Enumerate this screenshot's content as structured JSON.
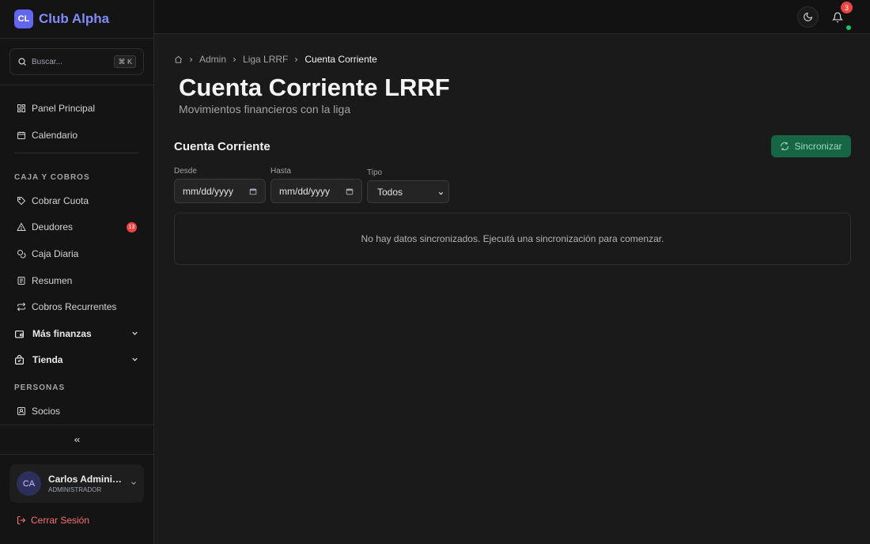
{
  "brand": {
    "logo": "CL",
    "name": "Club Alpha"
  },
  "search": {
    "placeholder": "Buscar...",
    "shortcut": "⌘ K"
  },
  "sidebar": {
    "top_items": [
      {
        "label": "Panel Principal",
        "icon": "dashboard-icon"
      },
      {
        "label": "Calendario",
        "icon": "calendar-icon"
      }
    ],
    "section_caja": "CAJA Y COBROS",
    "caja_items": [
      {
        "label": "Cobrar Cuota",
        "icon": "tag-icon"
      },
      {
        "label": "Deudores",
        "icon": "warning-icon",
        "badge": "13"
      },
      {
        "label": "Caja Diaria",
        "icon": "coins-icon"
      },
      {
        "label": "Resumen",
        "icon": "receipt-icon"
      },
      {
        "label": "Cobros Recurrentes",
        "icon": "repeat-icon"
      }
    ],
    "groups": [
      {
        "label": "Más finanzas",
        "icon": "wallet-icon"
      },
      {
        "label": "Tienda",
        "icon": "store-icon"
      }
    ],
    "section_personas": "PERSONAS",
    "personas_items": [
      {
        "label": "Socios",
        "icon": "id-card-icon"
      }
    ]
  },
  "user": {
    "initials": "CA",
    "name": "Carlos Administrador",
    "role": "ADMINISTRADOR"
  },
  "logout": {
    "label": "Cerrar Sesión"
  },
  "topbar": {
    "notifications": "3"
  },
  "breadcrumb": {
    "items": [
      "Admin",
      "Liga LRRF"
    ],
    "current": "Cuenta Corriente"
  },
  "page": {
    "title": "Cuenta Corriente LRRF",
    "subtitle": "Movimientos financieros con la liga"
  },
  "card": {
    "title": "Cuenta Corriente",
    "sync_label": "Sincronizar"
  },
  "filters": {
    "desde_label": "Desde",
    "desde_value": "mm/dd/yyyy",
    "hasta_label": "Hasta",
    "hasta_value": "mm/dd/yyyy",
    "tipo_label": "Tipo",
    "tipo_value": "Todos"
  },
  "empty_message": "No hay datos sincronizados. Ejecutá una sincronización para comenzar.",
  "colors": {
    "accent": "#6366f1",
    "brand_text": "#818cf8",
    "success": "#166545",
    "danger": "#ef4444",
    "logout": "#f87171"
  }
}
